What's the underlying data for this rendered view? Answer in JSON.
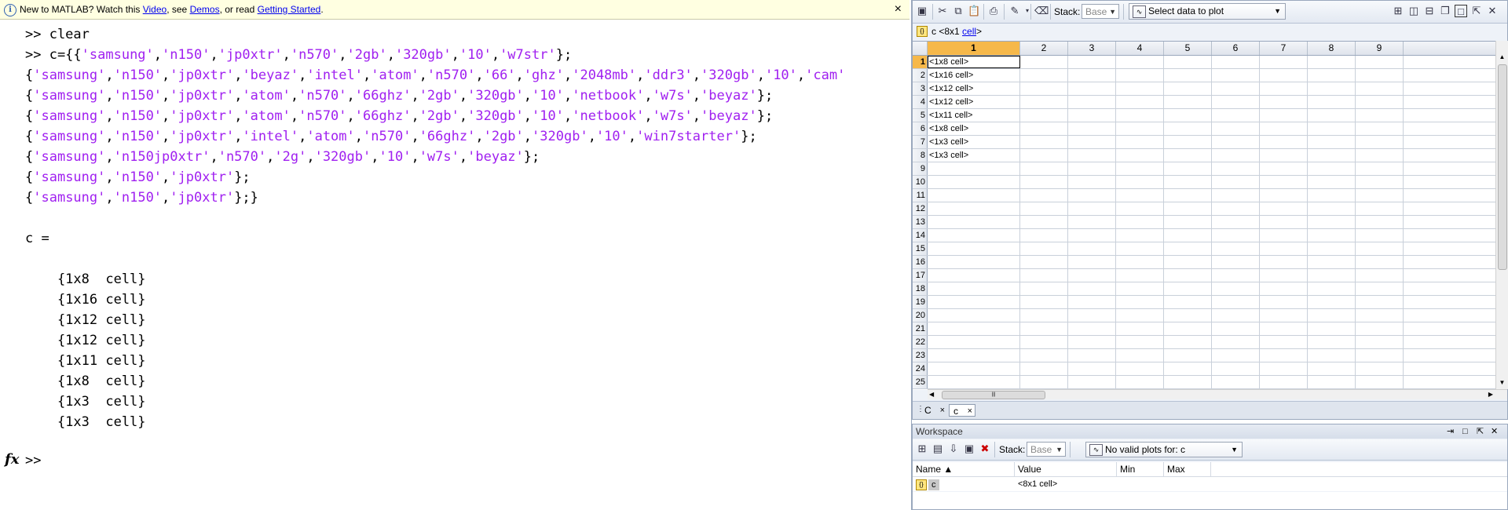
{
  "infobar": {
    "prefix": "New to MATLAB? Watch this ",
    "link_video": "Video",
    "mid1": ", see ",
    "link_demos": "Demos",
    "mid2": ", or read ",
    "link_started": "Getting Started",
    "suffix": ".",
    "close": "×"
  },
  "command_window": {
    "lines": [
      [
        {
          "t": ">> clear",
          "s": false
        }
      ],
      [
        {
          "t": ">> c={{",
          "s": false
        },
        {
          "t": "'samsung'",
          "s": true
        },
        {
          "t": ",",
          "s": false
        },
        {
          "t": "'n150'",
          "s": true
        },
        {
          "t": ",",
          "s": false
        },
        {
          "t": "'jp0xtr'",
          "s": true
        },
        {
          "t": ",",
          "s": false
        },
        {
          "t": "'n570'",
          "s": true
        },
        {
          "t": ",",
          "s": false
        },
        {
          "t": "'2gb'",
          "s": true
        },
        {
          "t": ",",
          "s": false
        },
        {
          "t": "'320gb'",
          "s": true
        },
        {
          "t": ",",
          "s": false
        },
        {
          "t": "'10'",
          "s": true
        },
        {
          "t": ",",
          "s": false
        },
        {
          "t": "'w7str'",
          "s": true
        },
        {
          "t": "};",
          "s": false
        }
      ],
      [
        {
          "t": "{",
          "s": false
        },
        {
          "t": "'samsung'",
          "s": true
        },
        {
          "t": ",",
          "s": false
        },
        {
          "t": "'n150'",
          "s": true
        },
        {
          "t": ",",
          "s": false
        },
        {
          "t": "'jp0xtr'",
          "s": true
        },
        {
          "t": ",",
          "s": false
        },
        {
          "t": "'beyaz'",
          "s": true
        },
        {
          "t": ",",
          "s": false
        },
        {
          "t": "'intel'",
          "s": true
        },
        {
          "t": ",",
          "s": false
        },
        {
          "t": "'atom'",
          "s": true
        },
        {
          "t": ",",
          "s": false
        },
        {
          "t": "'n570'",
          "s": true
        },
        {
          "t": ",",
          "s": false
        },
        {
          "t": "'66'",
          "s": true
        },
        {
          "t": ",",
          "s": false
        },
        {
          "t": "'ghz'",
          "s": true
        },
        {
          "t": ",",
          "s": false
        },
        {
          "t": "'2048mb'",
          "s": true
        },
        {
          "t": ",",
          "s": false
        },
        {
          "t": "'ddr3'",
          "s": true
        },
        {
          "t": ",",
          "s": false
        },
        {
          "t": "'320gb'",
          "s": true
        },
        {
          "t": ",",
          "s": false
        },
        {
          "t": "'10'",
          "s": true
        },
        {
          "t": ",",
          "s": false
        },
        {
          "t": "'cam'",
          "s": true
        }
      ],
      [
        {
          "t": "{",
          "s": false
        },
        {
          "t": "'samsung'",
          "s": true
        },
        {
          "t": ",",
          "s": false
        },
        {
          "t": "'n150'",
          "s": true
        },
        {
          "t": ",",
          "s": false
        },
        {
          "t": "'jp0xtr'",
          "s": true
        },
        {
          "t": ",",
          "s": false
        },
        {
          "t": "'atom'",
          "s": true
        },
        {
          "t": ",",
          "s": false
        },
        {
          "t": "'n570'",
          "s": true
        },
        {
          "t": ",",
          "s": false
        },
        {
          "t": "'66ghz'",
          "s": true
        },
        {
          "t": ",",
          "s": false
        },
        {
          "t": "'2gb'",
          "s": true
        },
        {
          "t": ",",
          "s": false
        },
        {
          "t": "'320gb'",
          "s": true
        },
        {
          "t": ",",
          "s": false
        },
        {
          "t": "'10'",
          "s": true
        },
        {
          "t": ",",
          "s": false
        },
        {
          "t": "'netbook'",
          "s": true
        },
        {
          "t": ",",
          "s": false
        },
        {
          "t": "'w7s'",
          "s": true
        },
        {
          "t": ",",
          "s": false
        },
        {
          "t": "'beyaz'",
          "s": true
        },
        {
          "t": "};",
          "s": false
        }
      ],
      [
        {
          "t": "{",
          "s": false
        },
        {
          "t": "'samsung'",
          "s": true
        },
        {
          "t": ",",
          "s": false
        },
        {
          "t": "'n150'",
          "s": true
        },
        {
          "t": ",",
          "s": false
        },
        {
          "t": "'jp0xtr'",
          "s": true
        },
        {
          "t": ",",
          "s": false
        },
        {
          "t": "'atom'",
          "s": true
        },
        {
          "t": ",",
          "s": false
        },
        {
          "t": "'n570'",
          "s": true
        },
        {
          "t": ",",
          "s": false
        },
        {
          "t": "'66ghz'",
          "s": true
        },
        {
          "t": ",",
          "s": false
        },
        {
          "t": "'2gb'",
          "s": true
        },
        {
          "t": ",",
          "s": false
        },
        {
          "t": "'320gb'",
          "s": true
        },
        {
          "t": ",",
          "s": false
        },
        {
          "t": "'10'",
          "s": true
        },
        {
          "t": ",",
          "s": false
        },
        {
          "t": "'netbook'",
          "s": true
        },
        {
          "t": ",",
          "s": false
        },
        {
          "t": "'w7s'",
          "s": true
        },
        {
          "t": ",",
          "s": false
        },
        {
          "t": "'beyaz'",
          "s": true
        },
        {
          "t": "};",
          "s": false
        }
      ],
      [
        {
          "t": "{",
          "s": false
        },
        {
          "t": "'samsung'",
          "s": true
        },
        {
          "t": ",",
          "s": false
        },
        {
          "t": "'n150'",
          "s": true
        },
        {
          "t": ",",
          "s": false
        },
        {
          "t": "'jp0xtr'",
          "s": true
        },
        {
          "t": ",",
          "s": false
        },
        {
          "t": "'intel'",
          "s": true
        },
        {
          "t": ",",
          "s": false
        },
        {
          "t": "'atom'",
          "s": true
        },
        {
          "t": ",",
          "s": false
        },
        {
          "t": "'n570'",
          "s": true
        },
        {
          "t": ",",
          "s": false
        },
        {
          "t": "'66ghz'",
          "s": true
        },
        {
          "t": ",",
          "s": false
        },
        {
          "t": "'2gb'",
          "s": true
        },
        {
          "t": ",",
          "s": false
        },
        {
          "t": "'320gb'",
          "s": true
        },
        {
          "t": ",",
          "s": false
        },
        {
          "t": "'10'",
          "s": true
        },
        {
          "t": ",",
          "s": false
        },
        {
          "t": "'win7starter'",
          "s": true
        },
        {
          "t": "};",
          "s": false
        }
      ],
      [
        {
          "t": "{",
          "s": false
        },
        {
          "t": "'samsung'",
          "s": true
        },
        {
          "t": ",",
          "s": false
        },
        {
          "t": "'n150jp0xtr'",
          "s": true
        },
        {
          "t": ",",
          "s": false
        },
        {
          "t": "'n570'",
          "s": true
        },
        {
          "t": ",",
          "s": false
        },
        {
          "t": "'2g'",
          "s": true
        },
        {
          "t": ",",
          "s": false
        },
        {
          "t": "'320gb'",
          "s": true
        },
        {
          "t": ",",
          "s": false
        },
        {
          "t": "'10'",
          "s": true
        },
        {
          "t": ",",
          "s": false
        },
        {
          "t": "'w7s'",
          "s": true
        },
        {
          "t": ",",
          "s": false
        },
        {
          "t": "'beyaz'",
          "s": true
        },
        {
          "t": "};",
          "s": false
        }
      ],
      [
        {
          "t": "{",
          "s": false
        },
        {
          "t": "'samsung'",
          "s": true
        },
        {
          "t": ",",
          "s": false
        },
        {
          "t": "'n150'",
          "s": true
        },
        {
          "t": ",",
          "s": false
        },
        {
          "t": "'jp0xtr'",
          "s": true
        },
        {
          "t": "};",
          "s": false
        }
      ],
      [
        {
          "t": "{",
          "s": false
        },
        {
          "t": "'samsung'",
          "s": true
        },
        {
          "t": ",",
          "s": false
        },
        {
          "t": "'n150'",
          "s": true
        },
        {
          "t": ",",
          "s": false
        },
        {
          "t": "'jp0xtr'",
          "s": true
        },
        {
          "t": "};}",
          "s": false
        }
      ],
      [
        {
          "t": "",
          "s": false
        }
      ],
      [
        {
          "t": "c =",
          "s": false
        }
      ],
      [
        {
          "t": "",
          "s": false
        }
      ],
      [
        {
          "t": "    {1x8  cell}",
          "s": false
        }
      ],
      [
        {
          "t": "    {1x16 cell}",
          "s": false
        }
      ],
      [
        {
          "t": "    {1x12 cell}",
          "s": false
        }
      ],
      [
        {
          "t": "    {1x12 cell}",
          "s": false
        }
      ],
      [
        {
          "t": "    {1x11 cell}",
          "s": false
        }
      ],
      [
        {
          "t": "    {1x8  cell}",
          "s": false
        }
      ],
      [
        {
          "t": "    {1x3  cell}",
          "s": false
        }
      ],
      [
        {
          "t": "    {1x3  cell}",
          "s": false
        }
      ]
    ],
    "fx": "fx",
    "prompt": ">>"
  },
  "colors": {
    "string": "#a020f0",
    "selected_header": "#f6b84a"
  },
  "variable_editor": {
    "toolbar": {
      "stack_label": "Stack:",
      "stack_value": "Base",
      "plot_select": "Select data to plot"
    },
    "var_prefix": "c <8x1 ",
    "var_link": "cell",
    "var_suffix": ">",
    "columns": [
      "1",
      "2",
      "3",
      "4",
      "5",
      "6",
      "7",
      "8",
      "9"
    ],
    "rows": [
      "1",
      "2",
      "3",
      "4",
      "5",
      "6",
      "7",
      "8",
      "9",
      "10",
      "11",
      "12",
      "13",
      "14",
      "15",
      "16",
      "17",
      "18",
      "19",
      "20",
      "21",
      "22",
      "23",
      "24",
      "25"
    ],
    "cells": [
      "<1x8 cell>",
      "<1x16 cell>",
      "<1x12 cell>",
      "<1x12 cell>",
      "<1x11 cell>",
      "<1x8 cell>",
      "<1x3 cell>",
      "<1x3 cell>"
    ],
    "tabs": [
      {
        "label": "C",
        "close": "×",
        "active": false
      },
      {
        "label": "c",
        "close": "×",
        "active": true
      }
    ]
  },
  "workspace": {
    "title": "Workspace",
    "stack_label": "Stack:",
    "stack_value": "Base",
    "plot_select": "No valid plots for: c",
    "headers": [
      "Name ▲",
      "Value",
      "Min",
      "Max"
    ],
    "var": {
      "name": "c",
      "value": "<8x1 cell>"
    }
  }
}
